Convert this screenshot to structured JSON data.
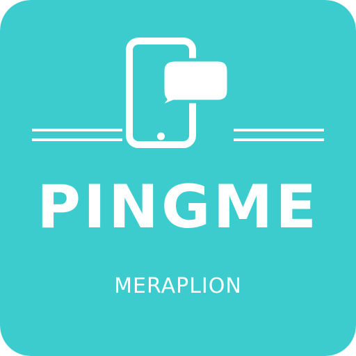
{
  "app": {
    "name": "PINGME",
    "developer": "MERAPLION"
  },
  "colors": {
    "background": "#3ccccd",
    "foreground": "#ffffff"
  },
  "icons": {
    "main": "smartphone-icon",
    "secondary": "speech-bubble-icon"
  }
}
